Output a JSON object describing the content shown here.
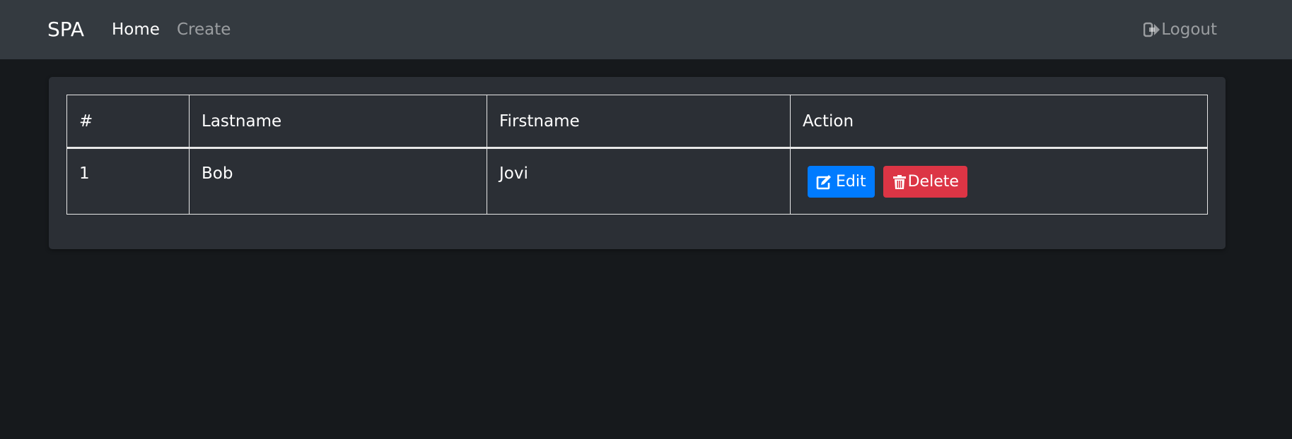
{
  "navbar": {
    "brand": "SPA",
    "links": [
      {
        "label": "Home"
      },
      {
        "label": "Create"
      }
    ],
    "logout_label": "Logout",
    "logout_icon": "sign-out-icon"
  },
  "table": {
    "headers": [
      "#",
      "Lastname",
      "Firstname",
      "Action"
    ],
    "rows": [
      {
        "num": "1",
        "lastname": "Bob",
        "firstname": "Jovi"
      }
    ],
    "edit_label": "Edit",
    "delete_label": "Delete",
    "edit_icon": "edit-icon",
    "delete_icon": "trash-icon"
  },
  "colors": {
    "navbar_bg": "#343a40",
    "page_bg": "#16191c",
    "card_bg": "#2b2f35",
    "edit_button": "#007bff",
    "delete_button": "#dc3545"
  }
}
